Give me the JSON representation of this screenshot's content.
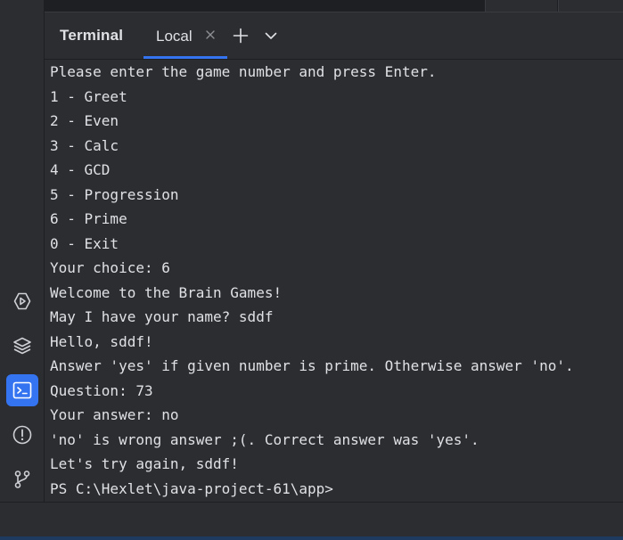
{
  "tool_window": {
    "title": "Terminal",
    "tab_label": "Local"
  },
  "terminal": {
    "lines": [
      "Please enter the game number and press Enter.",
      "1 - Greet",
      "2 - Even",
      "3 - Calc",
      "4 - GCD",
      "5 - Progression",
      "6 - Prime",
      "0 - Exit",
      "Your choice: 6",
      "Welcome to the Brain Games!",
      "May I have your name? sddf",
      "Hello, sddf!",
      "Answer 'yes' if given number is prime. Otherwise answer 'no'.",
      "Question: 73",
      "Your answer: no",
      "'no' is wrong answer ;(. Correct answer was 'yes'.",
      "Let's try again, sddf!",
      "PS C:\\Hexlet\\java-project-61\\app>"
    ]
  },
  "left_toolbar": {
    "icons": [
      "run-icon",
      "layers-icon",
      "terminal-icon",
      "problems-icon",
      "git-icon"
    ],
    "active": "terminal-icon"
  },
  "colors": {
    "background": "#1e1f22",
    "panel": "#2b2d30",
    "text": "#dfe1e5",
    "accent": "#3574f0",
    "icon": "#ced0d6"
  }
}
